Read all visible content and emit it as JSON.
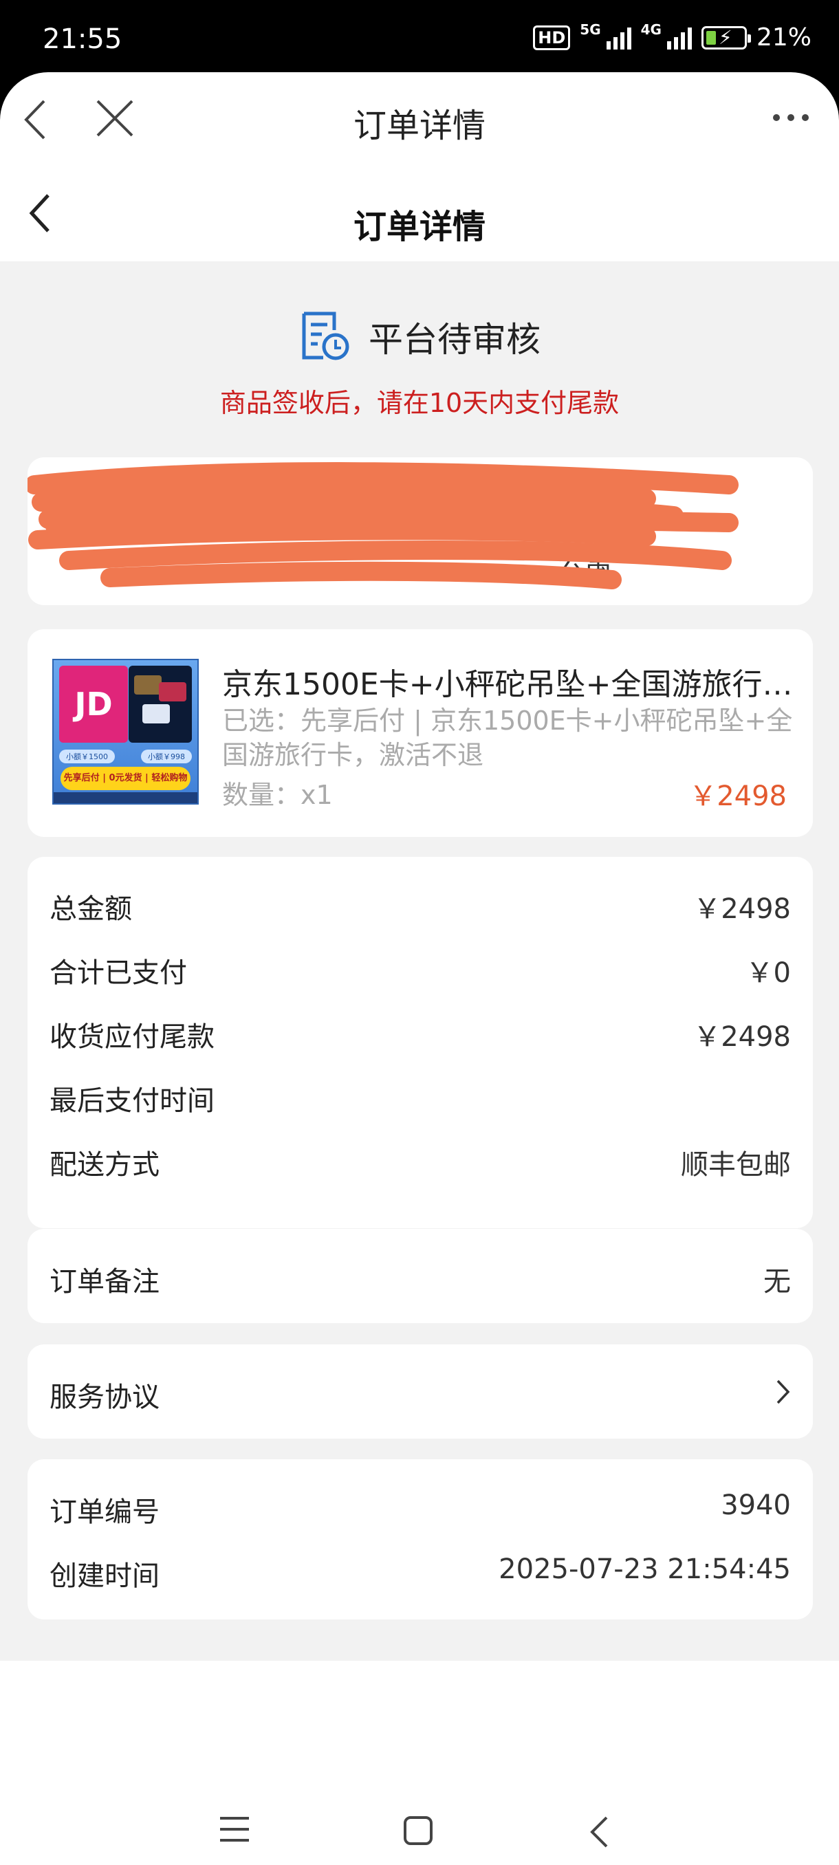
{
  "status_bar": {
    "time": "21:55",
    "hd_badge": "HD",
    "network_1": "5G",
    "network_2": "4G",
    "battery_percent": "21%"
  },
  "browser": {
    "title": "订单详情",
    "back_icon": "chevron-left-icon",
    "close_icon": "close-icon",
    "more_icon": "more-dots-icon"
  },
  "page": {
    "title": "订单详情"
  },
  "order_status": {
    "icon": "document-clock-icon",
    "label": "平台待审核",
    "note": "商品签收后，请在10天内支付尾款",
    "note_color": "#cc1f1f"
  },
  "address": {
    "visible_text": "公寓"
  },
  "product": {
    "name": "京东1500E卡+小秤砣吊坠+全国游旅行卡，激活不退",
    "spec": "已选：先享后付 | 京东1500E卡+小秤砣吊坠+全国游旅行卡，激活不退",
    "quantity": "数量：x1",
    "price": "￥2498",
    "price_color": "#e35a2f",
    "thumb": {
      "logo": "JD",
      "pill_left": "小额￥1500",
      "pill_right": "小额￥998",
      "banner": "先享后付 | 0元发货 | 轻松购物"
    }
  },
  "payment": {
    "rows": [
      {
        "label": "总金额",
        "value": "￥2498"
      },
      {
        "label": "合计已支付",
        "value": "￥0"
      },
      {
        "label": "收货应付尾款",
        "value": "￥2498"
      },
      {
        "label": "最后支付时间",
        "value": ""
      },
      {
        "label": "配送方式",
        "value": "顺丰包邮"
      }
    ]
  },
  "remark": {
    "label": "订单备注",
    "value": "无"
  },
  "service": {
    "label": "服务协议"
  },
  "order_info": {
    "rows": [
      {
        "label": "订单编号",
        "value": "3940"
      },
      {
        "label": "创建时间",
        "value": "2025-07-23 21:54:45"
      }
    ]
  },
  "nav_bar": {
    "menu_icon": "menu-icon",
    "home_icon": "home-icon",
    "back_icon": "back-icon"
  }
}
